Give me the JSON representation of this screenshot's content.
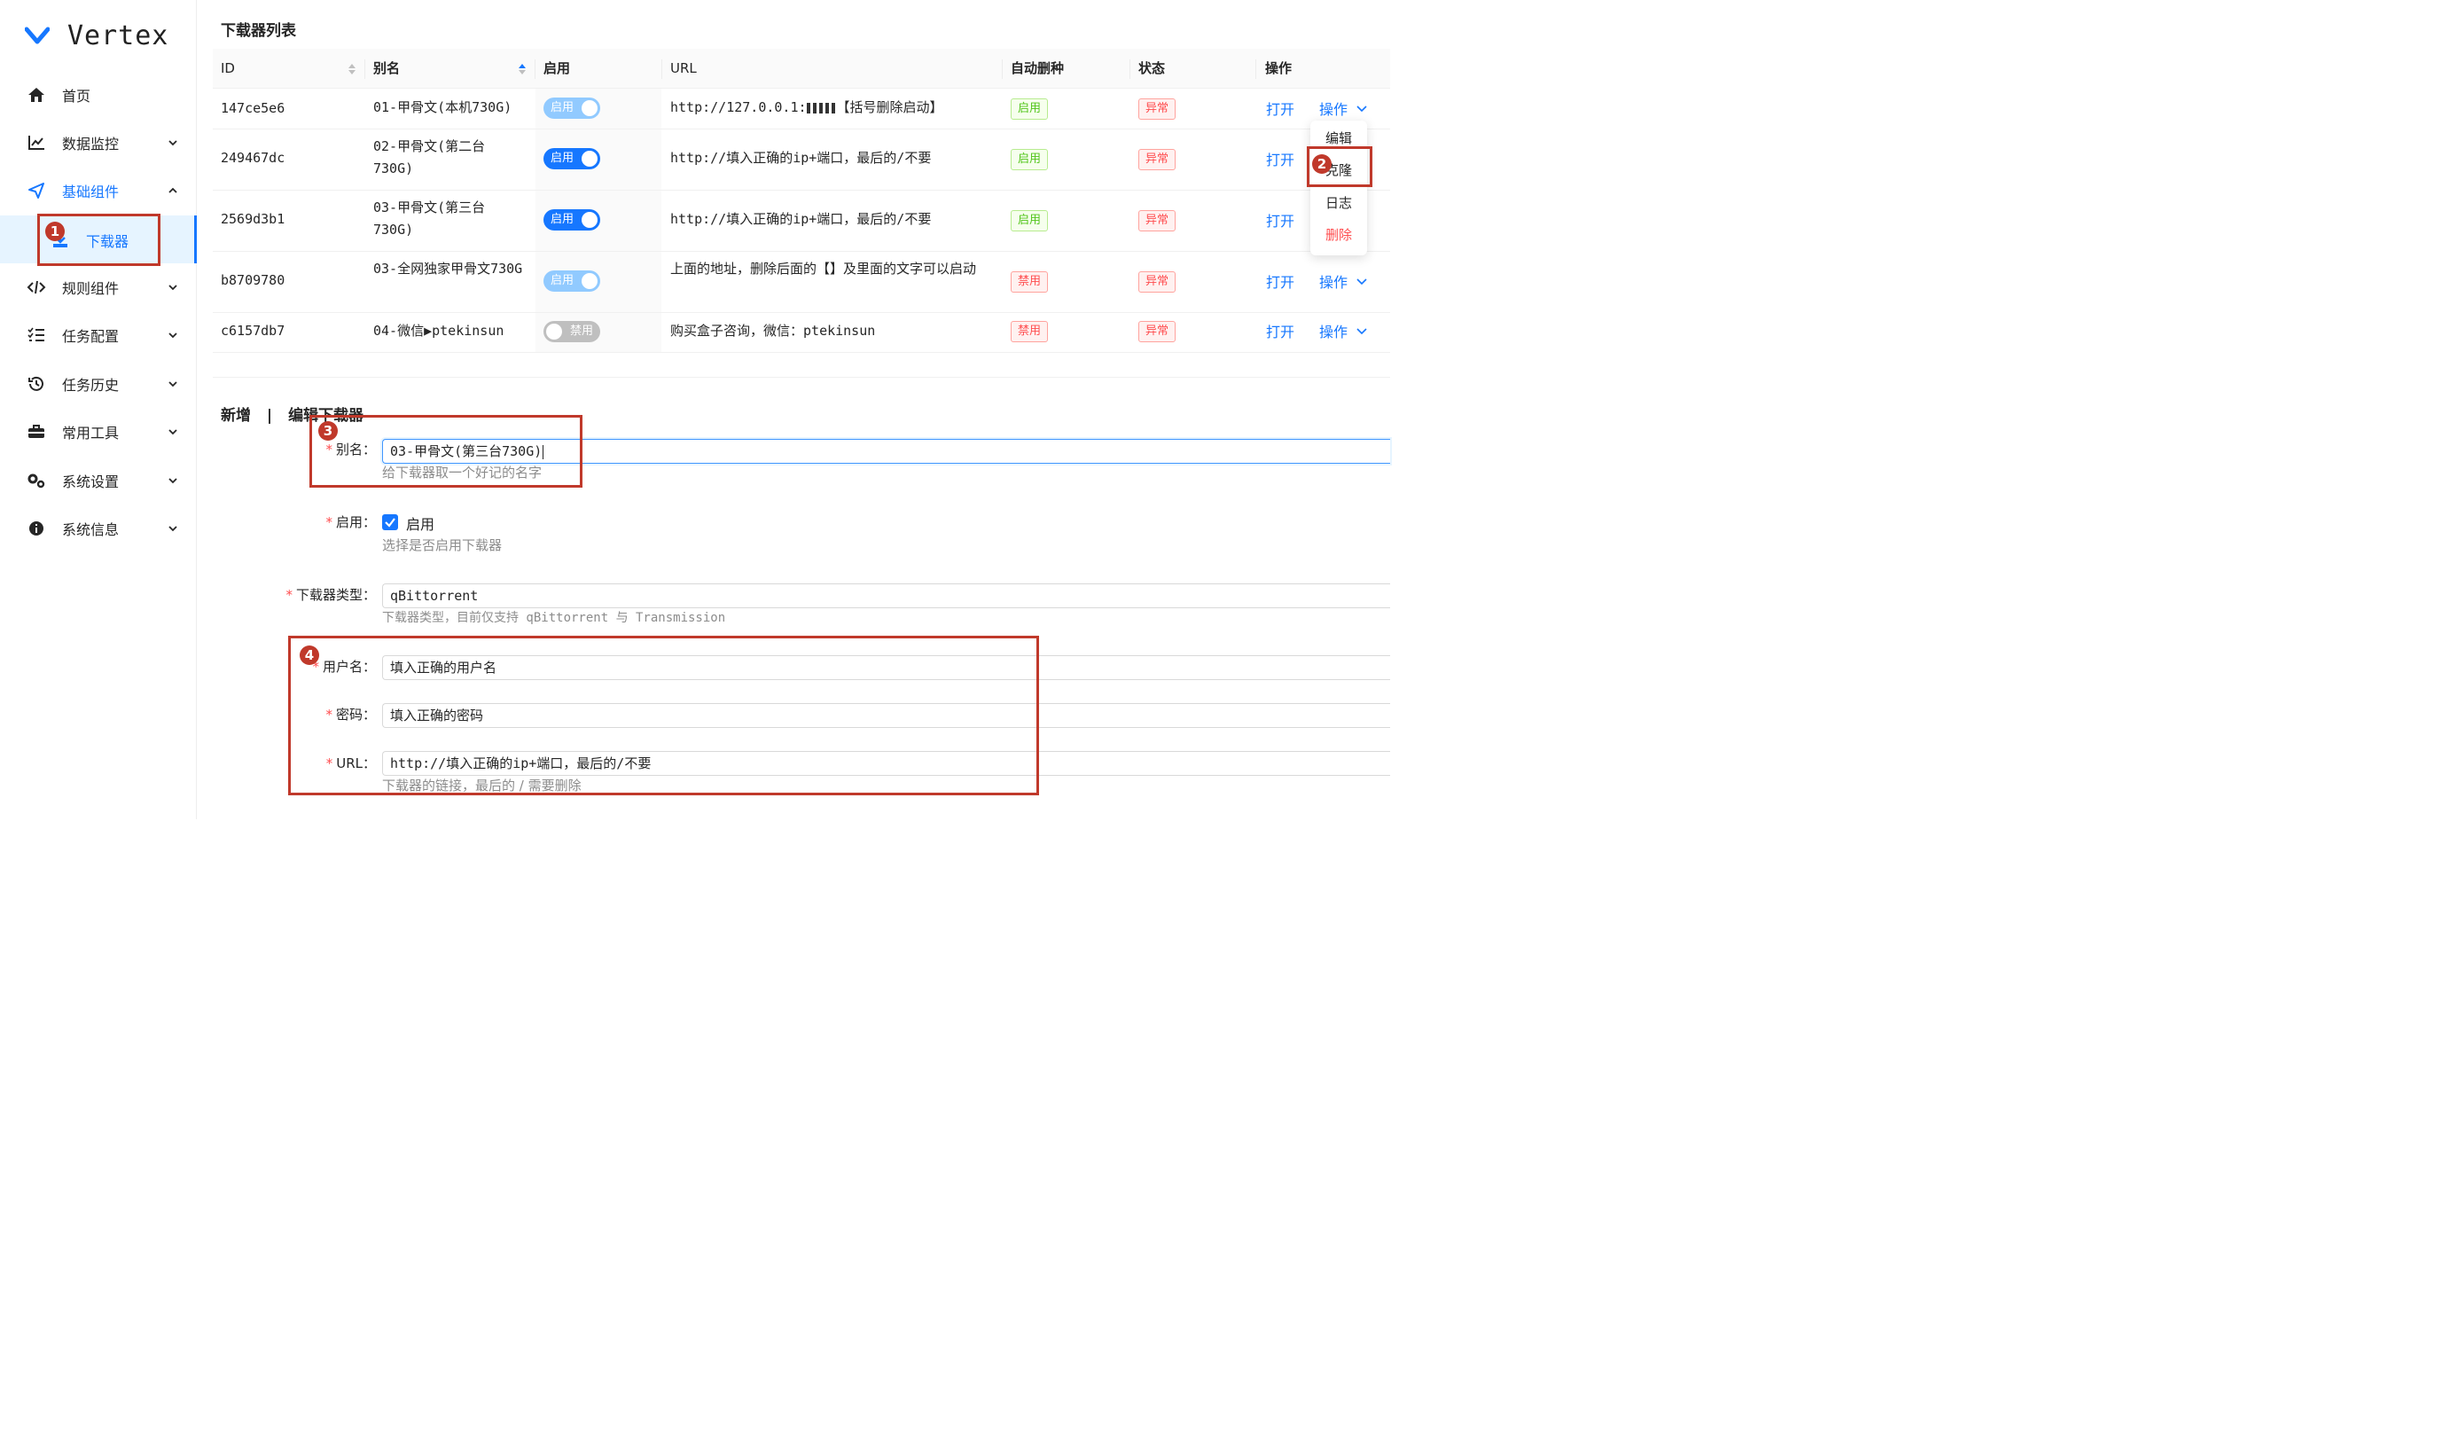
{
  "app": {
    "name": "Vertex"
  },
  "sidebar": {
    "items": [
      {
        "label": "首页",
        "icon": "home-icon",
        "expandable": false
      },
      {
        "label": "数据监控",
        "icon": "chart-line-icon",
        "expandable": true
      },
      {
        "label": "基础组件",
        "icon": "send-icon",
        "expandable": true,
        "expanded": true
      },
      {
        "label": "规则组件",
        "icon": "code-icon",
        "expandable": true
      },
      {
        "label": "任务配置",
        "icon": "list-check-icon",
        "expandable": true
      },
      {
        "label": "任务历史",
        "icon": "history-icon",
        "expandable": true
      },
      {
        "label": "常用工具",
        "icon": "toolbox-icon",
        "expandable": true
      },
      {
        "label": "系统设置",
        "icon": "gears-icon",
        "expandable": true
      },
      {
        "label": "系统信息",
        "icon": "info-icon",
        "expandable": true
      }
    ],
    "sub_item": {
      "label": "下载器",
      "icon": "download-icon"
    }
  },
  "list": {
    "title": "下载器列表",
    "columns": {
      "id": "ID",
      "alias": "别名",
      "enable": "启用",
      "url": "URL",
      "auto_delete": "自动删种",
      "status": "状态",
      "ops": "操作"
    },
    "rows": [
      {
        "id": "147ce5e6",
        "alias": "01-甲骨文(本机730G)",
        "enable": "启用",
        "enable_state": "on-dim",
        "url": "http://127.0.0.1:",
        "url_tail": "【括号删除启动】",
        "auto_delete": "启用",
        "auto_delete_color": "green",
        "status": "异常"
      },
      {
        "id": "249467dc",
        "alias": "02-甲骨文(第二台730G)",
        "enable": "启用",
        "enable_state": "on",
        "url": "http://填入正确的ip+端口，最后的/不要",
        "auto_delete": "启用",
        "auto_delete_color": "green",
        "status": "异常"
      },
      {
        "id": "2569d3b1",
        "alias": "03-甲骨文(第三台730G)",
        "enable": "启用",
        "enable_state": "on",
        "url": "http://填入正确的ip+端口，最后的/不要",
        "auto_delete": "启用",
        "auto_delete_color": "green",
        "status": "异常"
      },
      {
        "id": "b8709780",
        "alias": "03-全网独家甲骨文730G",
        "enable": "启用",
        "enable_state": "on-dim",
        "url": "上面的地址，删除后面的【】及里面的文字可以启动",
        "auto_delete": "禁用",
        "auto_delete_color": "red",
        "status": "异常"
      },
      {
        "id": "c6157db7",
        "alias": "04-微信▶ptekinsun",
        "enable": "禁用",
        "enable_state": "off",
        "url": "购买盒子咨询，微信：ptekinsun",
        "auto_delete": "禁用",
        "auto_delete_color": "red",
        "status": "异常"
      }
    ],
    "open_label": "打开",
    "ops_label": "操作",
    "dropdown": [
      "编辑",
      "克隆",
      "日志",
      "删除"
    ]
  },
  "form": {
    "title_new": "新增",
    "title_sep": "|",
    "title_edit": "编辑下载器",
    "alias": {
      "label": "别名：",
      "value": "03-甲骨文(第三台730G)",
      "help": "给下载器取一个好记的名字"
    },
    "enable": {
      "label": "启用：",
      "checkbox_label": "启用",
      "checked": true,
      "help": "选择是否启用下载器"
    },
    "type": {
      "label": "下载器类型：",
      "value": "qBittorrent",
      "help": "下载器类型，目前仅支持 qBittorrent 与 Transmission"
    },
    "username": {
      "label": "用户名：",
      "value": "填入正确的用户名"
    },
    "password": {
      "label": "密码：",
      "value": "填入正确的密码"
    },
    "url": {
      "label": "URL：",
      "value": "http://填入正确的ip+端口，最后的/不要",
      "help": "下载器的链接，最后的 / 需要删除"
    }
  },
  "annotations": [
    "1",
    "2",
    "3",
    "4"
  ],
  "colors": {
    "accent": "#1677ff",
    "annotation": "#c0392b",
    "danger": "#ff4d4f",
    "success": "#52c41a"
  }
}
